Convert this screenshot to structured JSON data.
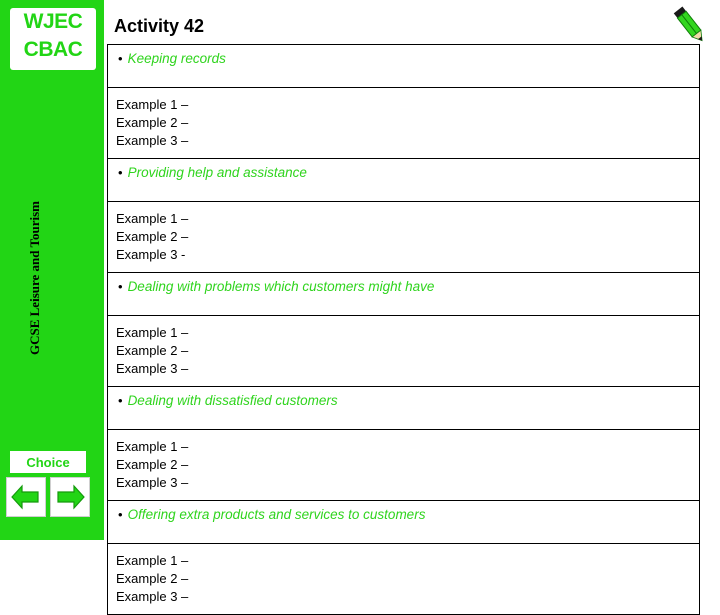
{
  "slide": {
    "title": "Activity 42",
    "accent_color": "#22d515",
    "bullet_text_color": "#2fd41d"
  },
  "sidebar": {
    "logo_line1": "WJEC",
    "logo_line2": "CBAC",
    "vertical_label": "GCSE Leisure and Tourism",
    "choice_label": "Choice",
    "prev_icon": "left-arrow-icon",
    "next_icon": "right-arrow-icon"
  },
  "header": {
    "pencil_icon": "pencil-icon"
  },
  "table": {
    "sections": [
      {
        "bullet": "Keeping records",
        "examples": [
          "Example 1 –",
          "Example 2 –",
          "Example 3 –"
        ]
      },
      {
        "bullet": "Providing help and assistance",
        "examples": [
          "Example 1 –",
          "Example 2 –",
          "Example 3 -"
        ]
      },
      {
        "bullet": "Dealing with problems which customers might have",
        "examples": [
          "Example 1 –",
          "Example 2 –",
          "Example 3 –"
        ]
      },
      {
        "bullet": "Dealing with dissatisfied customers",
        "examples": [
          "Example 1 –",
          "Example 2 –",
          "Example 3 –"
        ]
      },
      {
        "bullet": "Offering extra products and services to customers",
        "examples": [
          "Example 1 –",
          "Example 2 –",
          "Example 3 –"
        ]
      }
    ]
  }
}
